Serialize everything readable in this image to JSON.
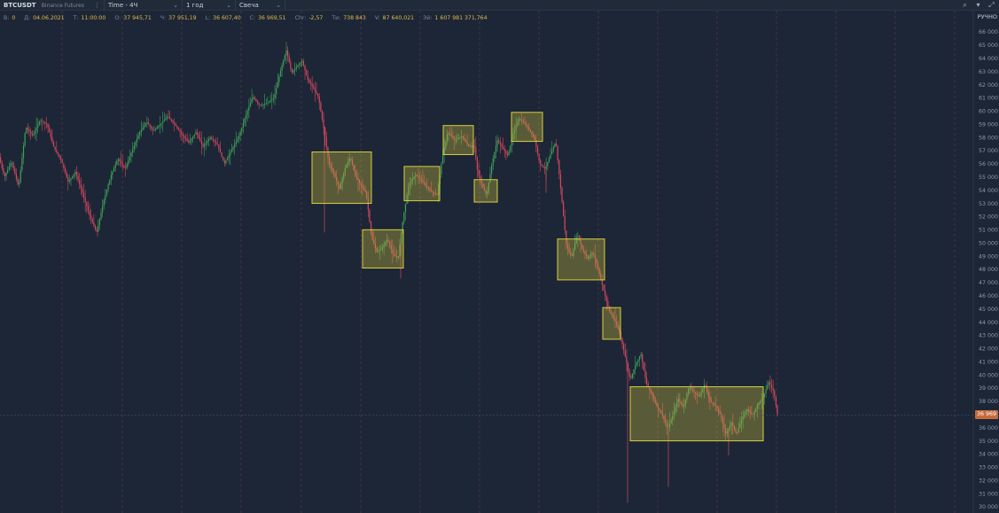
{
  "toolbar": {
    "symbol": "BTCUSDT",
    "exchange": "Binance Futures",
    "timeframe": "Time - 4Ч",
    "period": "1 год",
    "chart_type": "Свеча"
  },
  "ohlc": [
    {
      "label": "B:",
      "value": "0"
    },
    {
      "label": "Д:",
      "value": "04.06.2021"
    },
    {
      "label": "Т:",
      "value": "11:00:00"
    },
    {
      "label": "О:",
      "value": "37 945,71"
    },
    {
      "label": "Ч:",
      "value": "37 951,19"
    },
    {
      "label": "L:",
      "value": "36 607,40"
    },
    {
      "label": "С:",
      "value": "36 969,51"
    },
    {
      "label": "Chr:",
      "value": "-2,57"
    },
    {
      "label": "Ти:",
      "value": "738 843"
    },
    {
      "label": "V:",
      "value": "87 640,021"
    },
    {
      "label": "Эй:",
      "value": "1 607 981 371,764"
    }
  ],
  "axis": {
    "mode_label": "РУЧНО",
    "current_price_label": "36 969"
  },
  "colors": {
    "background": "#1c2636",
    "up": "#3fa05a",
    "down": "#d5485f",
    "box_border": "#d8cf3c",
    "box_fill": "rgba(190,180,60,0.38)",
    "price_tag": "#c46a3c"
  },
  "chart_data": {
    "type": "candlestick",
    "ylim": [
      30000,
      66000
    ],
    "yticks": [
      {
        "v": 30000,
        "label": "30 000"
      },
      {
        "v": 31000,
        "label": "31 000"
      },
      {
        "v": 32000,
        "label": "32 000"
      },
      {
        "v": 33000,
        "label": "33 000"
      },
      {
        "v": 34000,
        "label": "34 000"
      },
      {
        "v": 35000,
        "label": "35 000"
      },
      {
        "v": 36000,
        "label": "36 000"
      },
      {
        "v": 37000,
        "label": "37 000"
      },
      {
        "v": 38000,
        "label": "38 000"
      },
      {
        "v": 39000,
        "label": "39 000"
      },
      {
        "v": 40000,
        "label": "40 000"
      },
      {
        "v": 41000,
        "label": "41 000"
      },
      {
        "v": 42000,
        "label": "42 000"
      },
      {
        "v": 43000,
        "label": "43 000"
      },
      {
        "v": 44000,
        "label": "44 000"
      },
      {
        "v": 45000,
        "label": "45 000"
      },
      {
        "v": 46000,
        "label": "46 000"
      },
      {
        "v": 47000,
        "label": "47 000"
      },
      {
        "v": 48000,
        "label": "48 000"
      },
      {
        "v": 49000,
        "label": "49 000"
      },
      {
        "v": 50000,
        "label": "50 000"
      },
      {
        "v": 51000,
        "label": "51 000"
      },
      {
        "v": 52000,
        "label": "52 000"
      },
      {
        "v": 53000,
        "label": "53 000"
      },
      {
        "v": 54000,
        "label": "54 000"
      },
      {
        "v": 55000,
        "label": "55 000"
      },
      {
        "v": 56000,
        "label": "56 000"
      },
      {
        "v": 57000,
        "label": "57 000"
      },
      {
        "v": 58000,
        "label": "58 000"
      },
      {
        "v": 59000,
        "label": "59 000"
      },
      {
        "v": 60000,
        "label": "60 000"
      },
      {
        "v": 61000,
        "label": "61 000"
      },
      {
        "v": 62000,
        "label": "62 000"
      },
      {
        "v": 63000,
        "label": "63 000"
      },
      {
        "v": 64000,
        "label": "64 000"
      },
      {
        "v": 65000,
        "label": "65 000"
      },
      {
        "v": 66000,
        "label": "66 000"
      }
    ],
    "current_price": 36969,
    "price_path": [
      [
        0,
        56500
      ],
      [
        6,
        55000
      ],
      [
        14,
        56200
      ],
      [
        22,
        54200
      ],
      [
        30,
        58800
      ],
      [
        38,
        58100
      ],
      [
        46,
        59300
      ],
      [
        54,
        59000
      ],
      [
        62,
        57200
      ],
      [
        70,
        56300
      ],
      [
        78,
        54600
      ],
      [
        86,
        55400
      ],
      [
        94,
        53800
      ],
      [
        102,
        52100
      ],
      [
        110,
        50800
      ],
      [
        118,
        53200
      ],
      [
        126,
        55100
      ],
      [
        134,
        56400
      ],
      [
        142,
        55600
      ],
      [
        150,
        57000
      ],
      [
        158,
        58300
      ],
      [
        166,
        59200
      ],
      [
        174,
        58500
      ],
      [
        182,
        59000
      ],
      [
        190,
        59600
      ],
      [
        198,
        59000
      ],
      [
        206,
        58200
      ],
      [
        214,
        57600
      ],
      [
        222,
        58400
      ],
      [
        230,
        57300
      ],
      [
        238,
        58000
      ],
      [
        246,
        57500
      ],
      [
        254,
        56000
      ],
      [
        262,
        57000
      ],
      [
        270,
        58000
      ],
      [
        278,
        59600
      ],
      [
        286,
        61100
      ],
      [
        294,
        60400
      ],
      [
        302,
        60600
      ],
      [
        310,
        61000
      ],
      [
        318,
        63200
      ],
      [
        324,
        64600
      ],
      [
        330,
        62900
      ],
      [
        336,
        63400
      ],
      [
        342,
        63800
      ],
      [
        348,
        62400
      ],
      [
        354,
        61800
      ],
      [
        360,
        61100
      ],
      [
        366,
        58800
      ],
      [
        372,
        56000
      ],
      [
        378,
        55200
      ],
      [
        384,
        54100
      ],
      [
        390,
        55600
      ],
      [
        396,
        56500
      ],
      [
        402,
        55100
      ],
      [
        408,
        54400
      ],
      [
        414,
        53800
      ],
      [
        420,
        50500
      ],
      [
        426,
        49300
      ],
      [
        432,
        49600
      ],
      [
        438,
        50300
      ],
      [
        444,
        49200
      ],
      [
        450,
        48800
      ],
      [
        456,
        52000
      ],
      [
        462,
        54400
      ],
      [
        470,
        55200
      ],
      [
        478,
        54600
      ],
      [
        486,
        54000
      ],
      [
        494,
        53600
      ],
      [
        500,
        56500
      ],
      [
        506,
        58400
      ],
      [
        514,
        57800
      ],
      [
        522,
        58100
      ],
      [
        530,
        57300
      ],
      [
        536,
        57400
      ],
      [
        540,
        55300
      ],
      [
        546,
        54200
      ],
      [
        550,
        53600
      ],
      [
        556,
        56000
      ],
      [
        562,
        57800
      ],
      [
        568,
        57200
      ],
      [
        574,
        56600
      ],
      [
        580,
        58300
      ],
      [
        586,
        59400
      ],
      [
        592,
        59100
      ],
      [
        598,
        58600
      ],
      [
        604,
        57900
      ],
      [
        610,
        56000
      ],
      [
        616,
        55600
      ],
      [
        622,
        56700
      ],
      [
        628,
        57700
      ],
      [
        634,
        53800
      ],
      [
        640,
        49800
      ],
      [
        646,
        48900
      ],
      [
        652,
        50700
      ],
      [
        658,
        49500
      ],
      [
        664,
        48800
      ],
      [
        670,
        49300
      ],
      [
        676,
        48000
      ],
      [
        682,
        46400
      ],
      [
        688,
        44900
      ],
      [
        694,
        44200
      ],
      [
        700,
        43200
      ],
      [
        706,
        41500
      ],
      [
        712,
        39600
      ],
      [
        718,
        40800
      ],
      [
        724,
        41600
      ],
      [
        730,
        39400
      ],
      [
        736,
        38600
      ],
      [
        742,
        37600
      ],
      [
        748,
        37000
      ],
      [
        754,
        35900
      ],
      [
        760,
        36900
      ],
      [
        766,
        38200
      ],
      [
        772,
        37500
      ],
      [
        778,
        39100
      ],
      [
        784,
        38700
      ],
      [
        790,
        38300
      ],
      [
        796,
        39300
      ],
      [
        802,
        38000
      ],
      [
        808,
        37700
      ],
      [
        814,
        36900
      ],
      [
        820,
        35500
      ],
      [
        826,
        36400
      ],
      [
        832,
        35500
      ],
      [
        838,
        36700
      ],
      [
        844,
        37400
      ],
      [
        850,
        36900
      ],
      [
        856,
        37800
      ],
      [
        862,
        38300
      ],
      [
        868,
        39500
      ],
      [
        874,
        38700
      ],
      [
        878,
        37000
      ]
    ],
    "spikes": [
      [
        110,
        50500
      ],
      [
        366,
        50800
      ],
      [
        452,
        47300
      ],
      [
        616,
        53800
      ],
      [
        708,
        30300
      ],
      [
        754,
        31500
      ],
      [
        822,
        33900
      ]
    ],
    "boxes": [
      {
        "x0": 352,
        "x1": 419,
        "top": 56900,
        "bottom": 53000
      },
      {
        "x0": 409,
        "x1": 455,
        "top": 51000,
        "bottom": 48100
      },
      {
        "x0": 456,
        "x1": 496,
        "top": 55800,
        "bottom": 53200
      },
      {
        "x0": 500,
        "x1": 534,
        "top": 58900,
        "bottom": 56700
      },
      {
        "x0": 535,
        "x1": 561,
        "top": 54800,
        "bottom": 53100
      },
      {
        "x0": 577,
        "x1": 612,
        "top": 59900,
        "bottom": 57700
      },
      {
        "x0": 629,
        "x1": 682,
        "top": 50300,
        "bottom": 47200
      },
      {
        "x0": 680,
        "x1": 700,
        "top": 45100,
        "bottom": 42700
      },
      {
        "x0": 711,
        "x1": 861,
        "top": 39100,
        "bottom": 35000
      }
    ],
    "vgrid": [
      70,
      138,
      205,
      272,
      340,
      407,
      474,
      541,
      608,
      675,
      742,
      809,
      876,
      943,
      1010,
      1077
    ]
  }
}
